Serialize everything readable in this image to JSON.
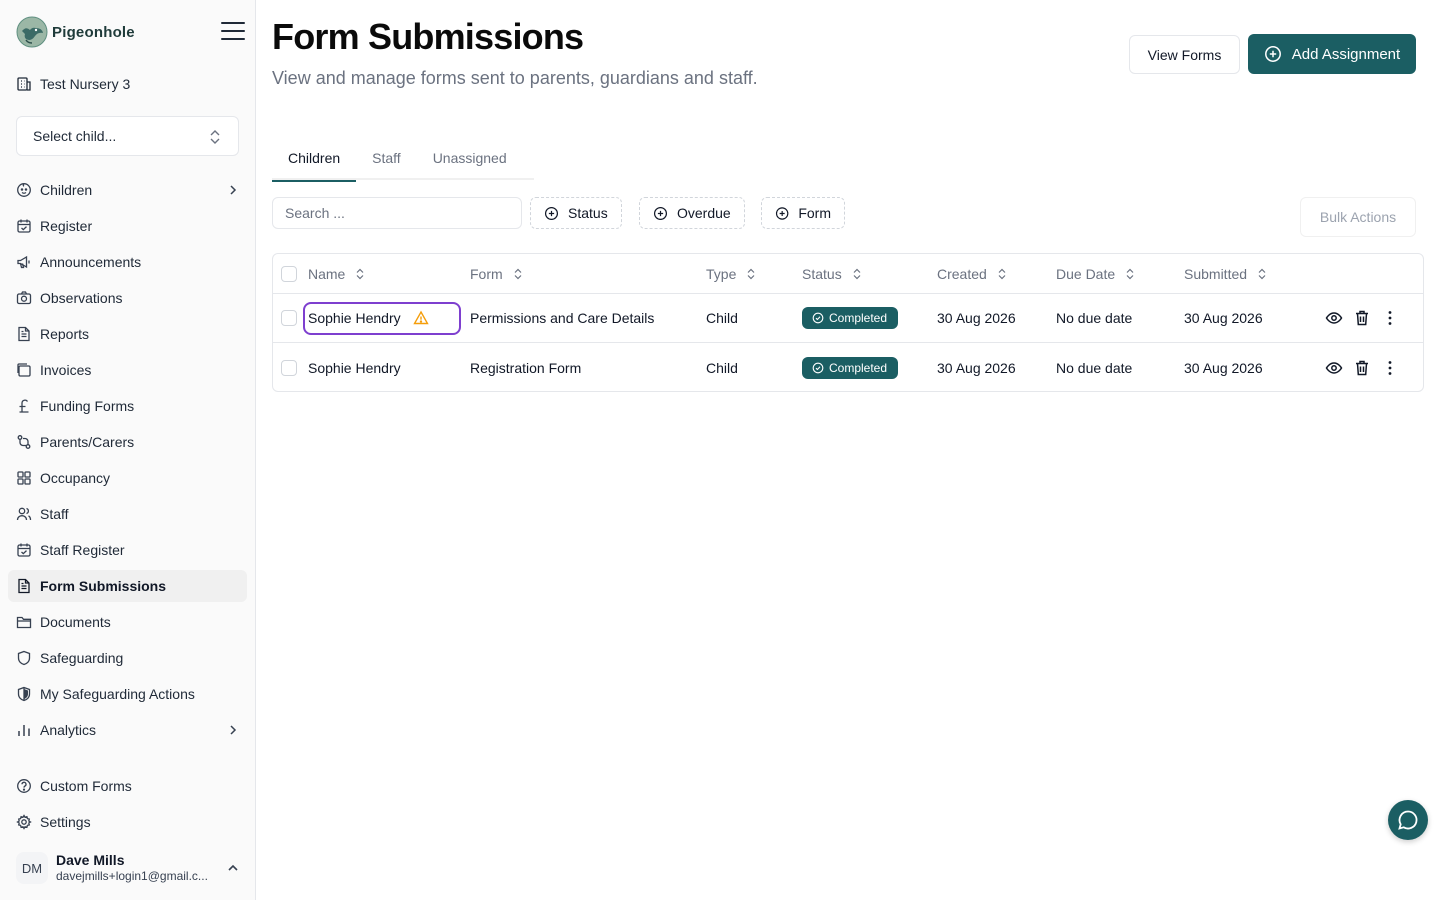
{
  "app": {
    "brand": "Pigeonhole",
    "nursery": "Test Nursery 3"
  },
  "colors": {
    "accent": "#1b5e63",
    "highlight": "#7e3fcf",
    "warning": "#f59e0b"
  },
  "child_select": {
    "placeholder": "Select child..."
  },
  "sidebar": {
    "items": [
      {
        "label": "Children",
        "icon": "baby-face-icon"
      },
      {
        "label": "Register",
        "icon": "calendar-check-icon"
      },
      {
        "label": "Announcements",
        "icon": "megaphone-icon"
      },
      {
        "label": "Observations",
        "icon": "camera-icon"
      },
      {
        "label": "Reports",
        "icon": "file-text-icon"
      },
      {
        "label": "Invoices",
        "icon": "receipt-icon"
      },
      {
        "label": "Funding Forms",
        "icon": "pound-sign-icon"
      },
      {
        "label": "Parents/Carers",
        "icon": "people-link-icon"
      },
      {
        "label": "Occupancy",
        "icon": "grid-icon"
      },
      {
        "label": "Staff",
        "icon": "users-icon"
      },
      {
        "label": "Staff Register",
        "icon": "calendar-check-icon"
      },
      {
        "label": "Form Submissions",
        "icon": "file-text-icon"
      },
      {
        "label": "Documents",
        "icon": "folder-icon"
      },
      {
        "label": "Safeguarding",
        "icon": "shield-icon"
      },
      {
        "label": "My Safeguarding Actions",
        "icon": "shield-half-icon"
      },
      {
        "label": "Analytics",
        "icon": "bar-chart-icon"
      }
    ],
    "footer_items": [
      {
        "label": "Custom Forms",
        "icon": "help-circle-icon"
      },
      {
        "label": "Settings",
        "icon": "gear-icon"
      }
    ],
    "user": {
      "initials": "DM",
      "name": "Dave Mills",
      "email": "davejmills+login1@gmail.c..."
    }
  },
  "header": {
    "title": "Form Submissions",
    "subtitle": "View and manage forms sent to parents, guardians and staff.",
    "view_forms": "View Forms",
    "add_assignment": "Add Assignment"
  },
  "tabs": [
    "Children",
    "Staff",
    "Unassigned"
  ],
  "filters": {
    "search_placeholder": "Search ...",
    "status": "Status",
    "overdue": "Overdue",
    "form": "Form",
    "bulk_actions": "Bulk Actions"
  },
  "table": {
    "columns": [
      "Name",
      "Form",
      "Type",
      "Status",
      "Created",
      "Due Date",
      "Submitted"
    ],
    "rows": [
      {
        "name": "Sophie Hendry",
        "form": "Permissions and Care Details",
        "type": "Child",
        "status": "Completed",
        "created": "30 Aug 2026",
        "due": "No due date",
        "submitted": "30 Aug 2026"
      },
      {
        "name": "Sophie Hendry",
        "form": "Registration Form",
        "type": "Child",
        "status": "Completed",
        "created": "30 Aug 2026",
        "due": "No due date",
        "submitted": "30 Aug 2026"
      }
    ]
  }
}
